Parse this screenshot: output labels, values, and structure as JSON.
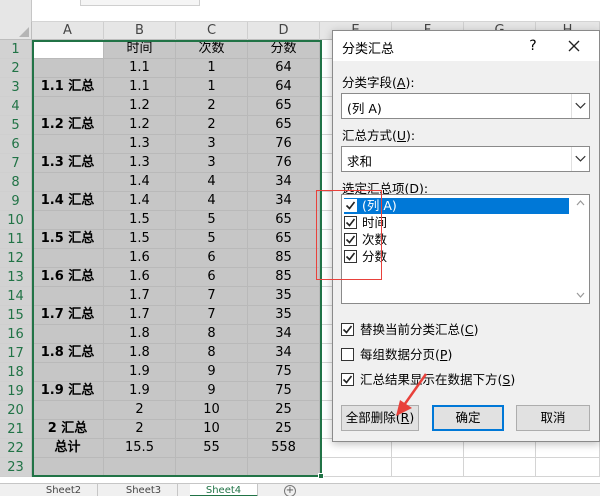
{
  "spreadsheet": {
    "columns": [
      "A",
      "B",
      "C",
      "D",
      "E",
      "F",
      "G",
      "H"
    ],
    "rows": [
      {
        "num": "1",
        "a": "",
        "b": "时间",
        "c": "次数",
        "d": "分数"
      },
      {
        "num": "2",
        "a": "",
        "b": "1.1",
        "c": "1",
        "d": "64"
      },
      {
        "num": "3",
        "a": "1.1 汇总",
        "b": "1.1",
        "c": "1",
        "d": "64"
      },
      {
        "num": "4",
        "a": "",
        "b": "1.2",
        "c": "2",
        "d": "65"
      },
      {
        "num": "5",
        "a": "1.2 汇总",
        "b": "1.2",
        "c": "2",
        "d": "65"
      },
      {
        "num": "6",
        "a": "",
        "b": "1.3",
        "c": "3",
        "d": "76"
      },
      {
        "num": "7",
        "a": "1.3 汇总",
        "b": "1.3",
        "c": "3",
        "d": "76"
      },
      {
        "num": "8",
        "a": "",
        "b": "1.4",
        "c": "4",
        "d": "34"
      },
      {
        "num": "9",
        "a": "1.4 汇总",
        "b": "1.4",
        "c": "4",
        "d": "34"
      },
      {
        "num": "10",
        "a": "",
        "b": "1.5",
        "c": "5",
        "d": "65"
      },
      {
        "num": "11",
        "a": "1.5 汇总",
        "b": "1.5",
        "c": "5",
        "d": "65"
      },
      {
        "num": "12",
        "a": "",
        "b": "1.6",
        "c": "6",
        "d": "85"
      },
      {
        "num": "13",
        "a": "1.6 汇总",
        "b": "1.6",
        "c": "6",
        "d": "85"
      },
      {
        "num": "14",
        "a": "",
        "b": "1.7",
        "c": "7",
        "d": "35"
      },
      {
        "num": "15",
        "a": "1.7 汇总",
        "b": "1.7",
        "c": "7",
        "d": "35"
      },
      {
        "num": "16",
        "a": "",
        "b": "1.8",
        "c": "8",
        "d": "34"
      },
      {
        "num": "17",
        "a": "1.8 汇总",
        "b": "1.8",
        "c": "8",
        "d": "34"
      },
      {
        "num": "18",
        "a": "",
        "b": "1.9",
        "c": "9",
        "d": "75"
      },
      {
        "num": "19",
        "a": "1.9 汇总",
        "b": "1.9",
        "c": "9",
        "d": "75"
      },
      {
        "num": "20",
        "a": "",
        "b": "2",
        "c": "10",
        "d": "25"
      },
      {
        "num": "21",
        "a": "2 汇总",
        "b": "2",
        "c": "10",
        "d": "25"
      },
      {
        "num": "22",
        "a": "总计",
        "b": "15.5",
        "c": "55",
        "d": "558"
      },
      {
        "num": "23",
        "a": "",
        "b": "",
        "c": "",
        "d": ""
      }
    ],
    "sheet_tabs": [
      "Sheet2",
      "Sheet3",
      "Sheet4"
    ],
    "active_sheet_index": 2,
    "add_sheet": "+"
  },
  "dialog": {
    "title": "分类汇总",
    "help": "?",
    "group_field_label": "分类字段(",
    "group_field_key": "A",
    "group_field_suffix": "):",
    "group_field_value": "(列 A)",
    "function_label": "汇总方式(",
    "function_key": "U",
    "function_suffix": "):",
    "function_value": "求和",
    "items_label": "选定汇总项(",
    "items_key": "D",
    "items_suffix": "):",
    "items": [
      {
        "label": "(列 A)",
        "checked": true,
        "highlighted": true
      },
      {
        "label": "时间",
        "checked": true,
        "highlighted": false
      },
      {
        "label": "次数",
        "checked": true,
        "highlighted": false
      },
      {
        "label": "分数",
        "checked": true,
        "highlighted": false
      }
    ],
    "options": [
      {
        "text": "替换当前分类汇总(",
        "key": "C",
        "suffix": ")",
        "checked": true
      },
      {
        "text": "每组数据分页(",
        "key": "P",
        "suffix": ")",
        "checked": false
      },
      {
        "text": "汇总结果显示在数据下方(",
        "key": "S",
        "suffix": ")",
        "checked": true
      }
    ],
    "remove_all_text": "全部删除(",
    "remove_all_key": "R",
    "remove_all_suffix": ")",
    "ok_label": "确定",
    "cancel_label": "取消"
  },
  "colors": {
    "selection_fill": "#c6c6c6",
    "selection_border": "#217346",
    "highlight": "#0078d7",
    "annotation": "#e8413b"
  }
}
